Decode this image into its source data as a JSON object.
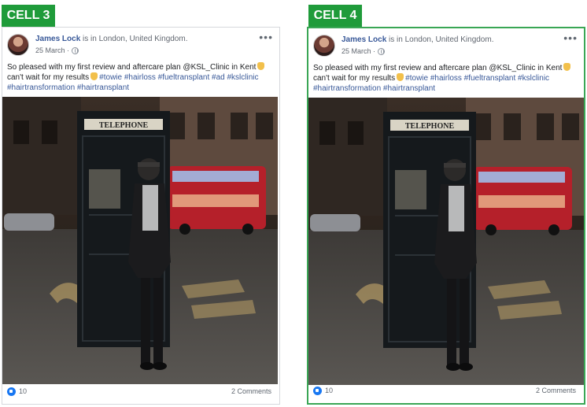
{
  "cells": [
    {
      "label": "CELL 3",
      "author": "James Lock",
      "location_prefix": "is in",
      "location": "London, United Kingdom.",
      "date": "25 March ·",
      "text_main": "So pleased with my first review and aftercare plan @KSL_Clinic in Kent",
      "text_line2": "can't wait for my results",
      "hashtags": "#towie #hairloss #fueltransplant #ad #kslclinic #hairtransformation #hairtransplant",
      "photo_sign": "TELEPHONE",
      "road_text": "STOP",
      "likes": "10",
      "comments": "2 Comments"
    },
    {
      "label": "CELL 4",
      "author": "James Lock",
      "location_prefix": "is in",
      "location": "London, United Kingdom.",
      "date": "25 March ·",
      "text_main": "So pleased with my first review and aftercare plan @KSL_Clinic in Kent",
      "text_line2": "can't wait for my results",
      "hashtags": "#towie #hairloss #fueltransplant #kslclinic #hairtransformation #hairtransplant",
      "photo_sign": "TELEPHONE",
      "road_text": "STOP",
      "likes": "10",
      "comments": "2 Comments"
    }
  ],
  "colors": {
    "cell_label_bg": "#1f9b3a",
    "link": "#385898",
    "like": "#1877f2",
    "frame": "#3aa655"
  },
  "icons": [
    "globe-icon",
    "more-icon",
    "like-icon",
    "clapping-emoji-icon",
    "ok-hand-emoji-icon",
    "avatar"
  ]
}
